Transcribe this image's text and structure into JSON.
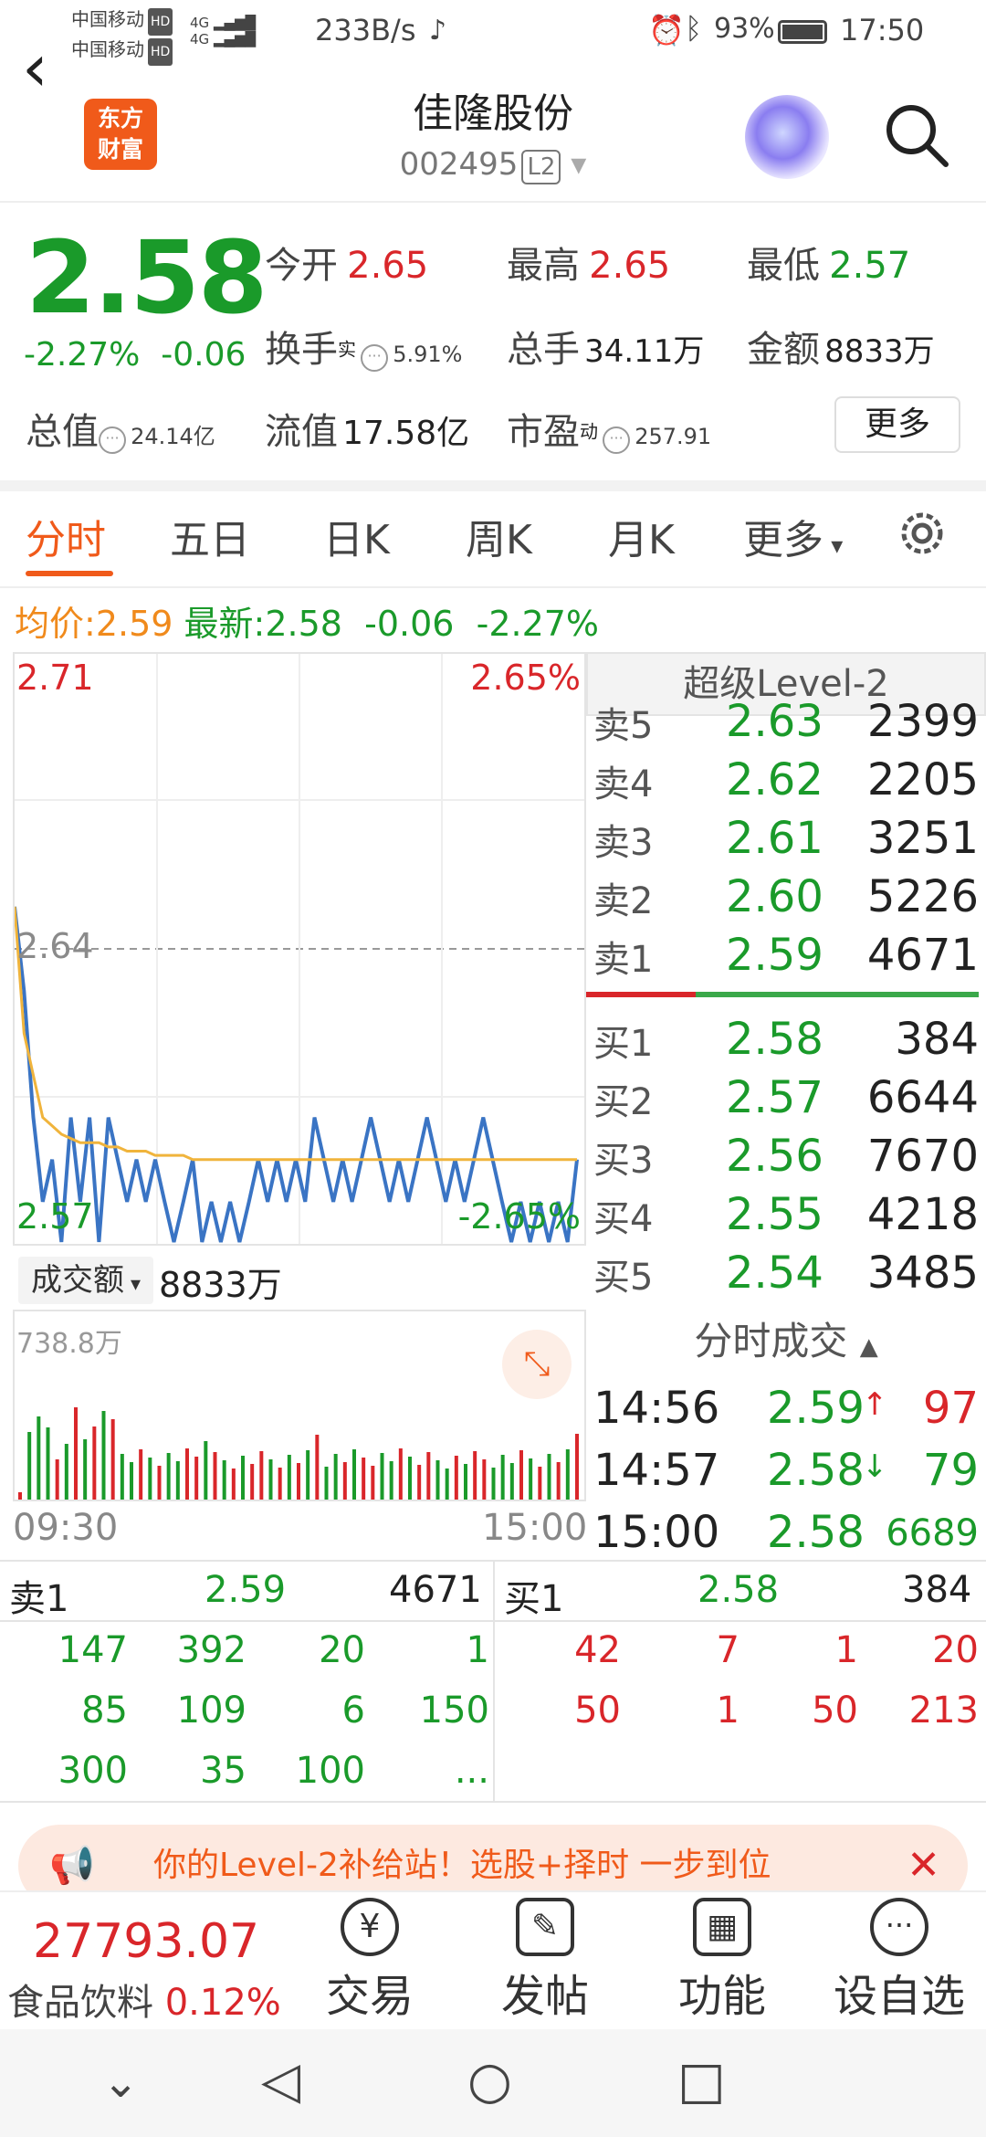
{
  "status_bar": {
    "carrier1": "中国移动",
    "carrier2": "中国移动",
    "hd": "HD",
    "net_speed": "233B/s",
    "battery_pct": "93%",
    "time": "17:50"
  },
  "nav": {
    "logo_text1": "东方",
    "logo_text2": "财富",
    "stock_name": "佳隆股份",
    "stock_code": "002495",
    "level": "L2"
  },
  "quote": {
    "price": "2.58",
    "change_pct": "-2.27%",
    "change": "-0.06",
    "open_label": "今开",
    "open": "2.65",
    "high_label": "最高",
    "high": "2.65",
    "low_label": "最低",
    "low": "2.57",
    "turnover_label": "换手",
    "turnover_sup": "实",
    "turnover": "5.91%",
    "volume_label": "总手",
    "volume": "34.11万",
    "amount_label": "金额",
    "amount": "8833万",
    "mktcap_label": "总值",
    "mktcap": "24.14亿",
    "float_label": "流值",
    "float_cap": "17.58亿",
    "pe_label": "市盈",
    "pe_sup": "动",
    "pe": "257.91",
    "more_button": "更多"
  },
  "tabs": [
    "分时",
    "五日",
    "日K",
    "周K",
    "月K",
    "更多"
  ],
  "avg_line": {
    "avg_label": "均价:",
    "avg_value": "2.59",
    "latest_label": "最新:",
    "latest_value": "2.58",
    "latest_change": "-0.06",
    "latest_pct": "-2.27%"
  },
  "chart_labels": {
    "top_left": "2.71",
    "top_right": "2.65%",
    "mid": "2.64",
    "bot_left": "2.57",
    "bot_right": "-2.65%",
    "vol_button": "成交额",
    "vol_value": "8833万",
    "vol_max": "738.8万",
    "time_start": "09:30",
    "time_end": "15:00"
  },
  "chart_data": {
    "type": "line",
    "ylim": [
      2.57,
      2.71
    ],
    "series": [
      {
        "values": [
          2.65,
          2.63,
          2.6,
          2.58,
          2.59,
          2.57,
          2.6,
          2.58,
          2.6,
          2.57,
          2.6,
          2.59,
          2.58,
          2.59,
          2.58,
          2.59,
          2.58,
          2.57,
          2.58,
          2.59,
          2.57,
          2.58,
          2.57,
          2.58,
          2.57,
          2.58,
          2.59,
          2.58,
          2.59,
          2.58,
          2.59,
          2.58,
          2.6,
          2.59,
          2.58,
          2.59,
          2.58,
          2.59,
          2.6,
          2.59,
          2.58,
          2.59,
          2.58,
          2.59,
          2.6,
          2.59,
          2.58,
          2.59,
          2.58,
          2.59,
          2.6,
          2.59,
          2.58,
          2.57,
          2.58,
          2.57,
          2.58,
          2.57,
          2.58,
          2.57,
          2.59
        ]
      },
      {
        "values": [
          2.65,
          2.62,
          2.61,
          2.6,
          2.598,
          2.596,
          2.595,
          2.594,
          2.594,
          2.594,
          2.593,
          2.593,
          2.592,
          2.592,
          2.592,
          2.591,
          2.591,
          2.591,
          2.591,
          2.59,
          2.59,
          2.59,
          2.59,
          2.59,
          2.59,
          2.59,
          2.59,
          2.59,
          2.59,
          2.59,
          2.59,
          2.59,
          2.59,
          2.59,
          2.59,
          2.59,
          2.59,
          2.59,
          2.59,
          2.59,
          2.59,
          2.59,
          2.59,
          2.59,
          2.59,
          2.59,
          2.59,
          2.59,
          2.59,
          2.59,
          2.59,
          2.59,
          2.59,
          2.59,
          2.59,
          2.59,
          2.59,
          2.59,
          2.59,
          2.59,
          2.59
        ]
      }
    ],
    "colors": [
      "#3a74c4",
      "#f0b43c"
    ]
  },
  "level2": {
    "header": "超级Level-2",
    "asks": [
      [
        "卖5",
        "2.63",
        "2399"
      ],
      [
        "卖4",
        "2.62",
        "2205"
      ],
      [
        "卖3",
        "2.61",
        "3251"
      ],
      [
        "卖2",
        "2.60",
        "5226"
      ],
      [
        "卖1",
        "2.59",
        "4671"
      ]
    ],
    "bids": [
      [
        "买1",
        "2.58",
        "384"
      ],
      [
        "买2",
        "2.57",
        "6644"
      ],
      [
        "买3",
        "2.56",
        "7670"
      ],
      [
        "买4",
        "2.55",
        "4218"
      ],
      [
        "买5",
        "2.54",
        "3485"
      ]
    ]
  },
  "trades": {
    "header": "分时成交",
    "rows": [
      [
        "14:56",
        "2.59",
        "↑",
        "97"
      ],
      [
        "14:57",
        "2.58",
        "↓",
        "79"
      ],
      [
        "15:00",
        "2.58",
        "",
        "6689"
      ]
    ]
  },
  "queue": {
    "sell_label": "卖1",
    "sell_price": "2.59",
    "sell_vol": "4671",
    "buy_label": "买1",
    "buy_price": "2.58",
    "buy_vol": "384",
    "sell_rows": [
      [
        "147",
        "392",
        "20",
        "1"
      ],
      [
        "85",
        "109",
        "6",
        "150"
      ],
      [
        "300",
        "35",
        "100",
        "..."
      ]
    ],
    "buy_rows": [
      [
        "42",
        "7",
        "1",
        "20"
      ],
      [
        "50",
        "1",
        "50",
        "213"
      ]
    ]
  },
  "banner": {
    "text": "你的Level-2补给站！选股+择时 一步到位"
  },
  "bottom": {
    "index_value": "27793.07",
    "index_name": "食品饮料",
    "index_pct": "0.12%",
    "tabs": [
      "交易",
      "发帖",
      "功能",
      "设自选"
    ]
  }
}
